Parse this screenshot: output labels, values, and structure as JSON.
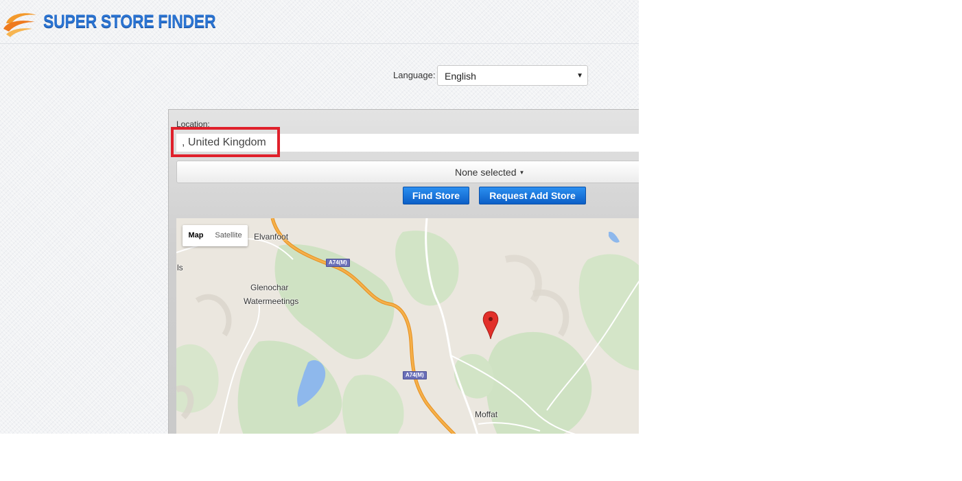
{
  "header": {
    "logo_text": "SUPER STORE FINDER"
  },
  "language": {
    "label": "Language:",
    "selected": "English"
  },
  "search": {
    "location_label": "Location:",
    "location_value": ", United Kingdom",
    "category_value": "None selected",
    "find_button": "Find Store",
    "request_button": "Request Add Store"
  },
  "map": {
    "type_map": "Map",
    "type_satellite": "Satellite",
    "place_labels": [
      "Elvanfoot",
      "ls",
      "Glenochar",
      "Watermeetings",
      "Moffat"
    ],
    "road_labels": [
      "A74(M)",
      "A74(M)"
    ]
  },
  "colors": {
    "brand_blue": "#2a73d1",
    "button_blue": "#0c5fc7",
    "highlight_red": "#e0202b",
    "motorway_orange": "#f2a23a",
    "marker_red": "#e2302a"
  }
}
